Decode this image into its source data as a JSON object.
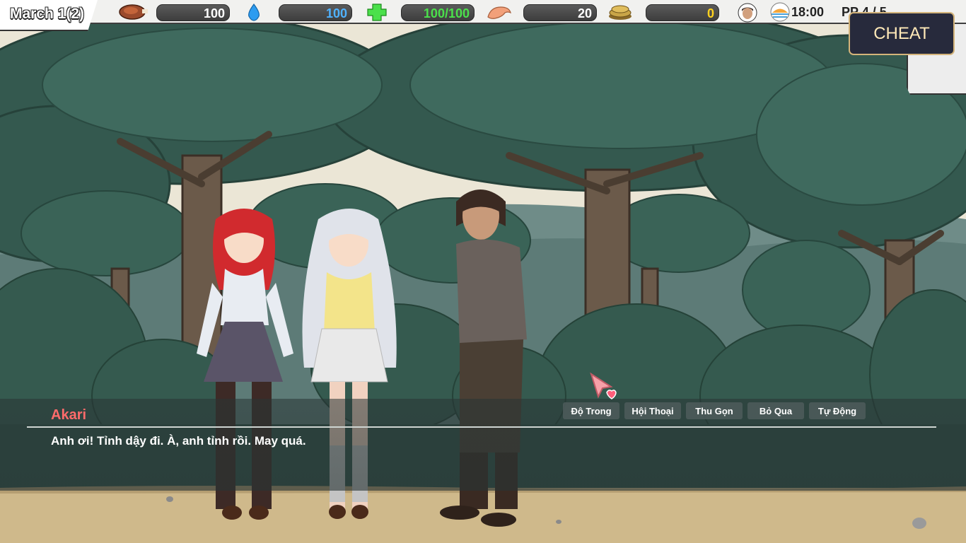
{
  "hud": {
    "date": "March 1(2)",
    "stats": [
      {
        "icon": "meat-icon",
        "value": "100",
        "color": "#ffffff"
      },
      {
        "icon": "water-drop-icon",
        "value": "100",
        "color": "#4fb2ff"
      },
      {
        "icon": "health-cross-icon",
        "value": "100/100",
        "color": "#4be04b"
      },
      {
        "icon": "arm-strength-icon",
        "value": "20",
        "color": "#ffffff"
      },
      {
        "icon": "gold-coins-icon",
        "value": "0",
        "color": "#ffd21e"
      }
    ],
    "time": "18:00",
    "pp": "PP 4 / 5",
    "cheat_label": "CHEAT"
  },
  "dialog": {
    "speaker": "Akari",
    "speaker_color": "#ff6b6b",
    "text": "Anh ơi! Tỉnh dậy đi. À, anh tỉnh rồi. May quá.",
    "buttons": [
      "Độ Trong",
      "Hội Thoại",
      "Thu Gọn",
      "Bỏ Qua",
      "Tự Động"
    ]
  }
}
